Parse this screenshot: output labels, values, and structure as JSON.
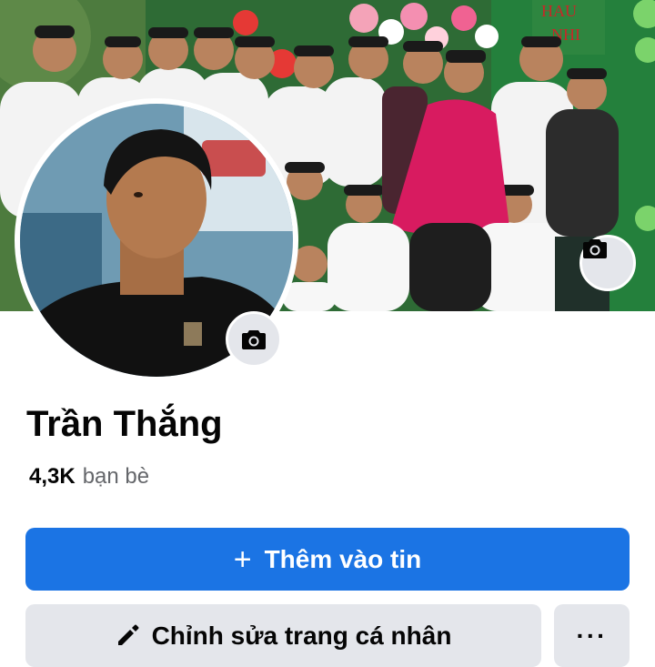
{
  "profile": {
    "name": "Trần Thắng",
    "friends_count": "4,3K",
    "friends_label": "bạn bè"
  },
  "cover": {
    "icon": "camera-icon",
    "sign_text_1": "HAU",
    "sign_text_2": "NHI"
  },
  "avatar": {
    "icon": "camera-icon"
  },
  "actions": {
    "add_story_icon": "plus-icon",
    "add_story_label": "Thêm vào tin",
    "edit_profile_icon": "pencil-icon",
    "edit_profile_label": "Chỉnh sửa trang cá nhân",
    "more_label": "···"
  },
  "colors": {
    "primary": "#1b74e4",
    "secondary_bg": "#e4e6eb",
    "text": "#050505",
    "muted": "#65676b"
  }
}
